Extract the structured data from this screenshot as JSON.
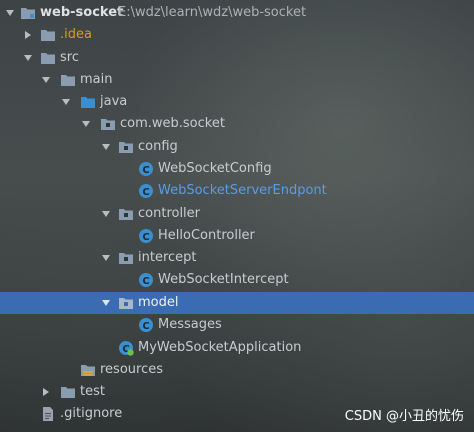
{
  "project": {
    "name": "web-socket",
    "path": "E:\\wdz\\learn\\wdz\\web-socket"
  },
  "nodes": {
    "idea": ".idea",
    "src": "src",
    "main": "main",
    "java": "java",
    "package": "com.web.socket",
    "config": "config",
    "web_socket_config": "WebSocketConfig",
    "web_socket_server_endpoint": "WebSocketServerEndpont",
    "controller": "controller",
    "hello_controller": "HelloController",
    "intercept": "intercept",
    "web_socket_intercept": "WebSocketIntercept",
    "model": "model",
    "messages": "Messages",
    "application": "MyWebSocketApplication",
    "resources": "resources",
    "test": "test",
    "gitignore": ".gitignore"
  },
  "watermark": "CSDN @小丑的忧伤",
  "colors": {
    "selection": "#3b6bb3",
    "folder": "#8a9cb0",
    "class_icon": "#3a8fd0",
    "orange_text": "#d99a2b",
    "blue_text": "#5c9be6"
  }
}
